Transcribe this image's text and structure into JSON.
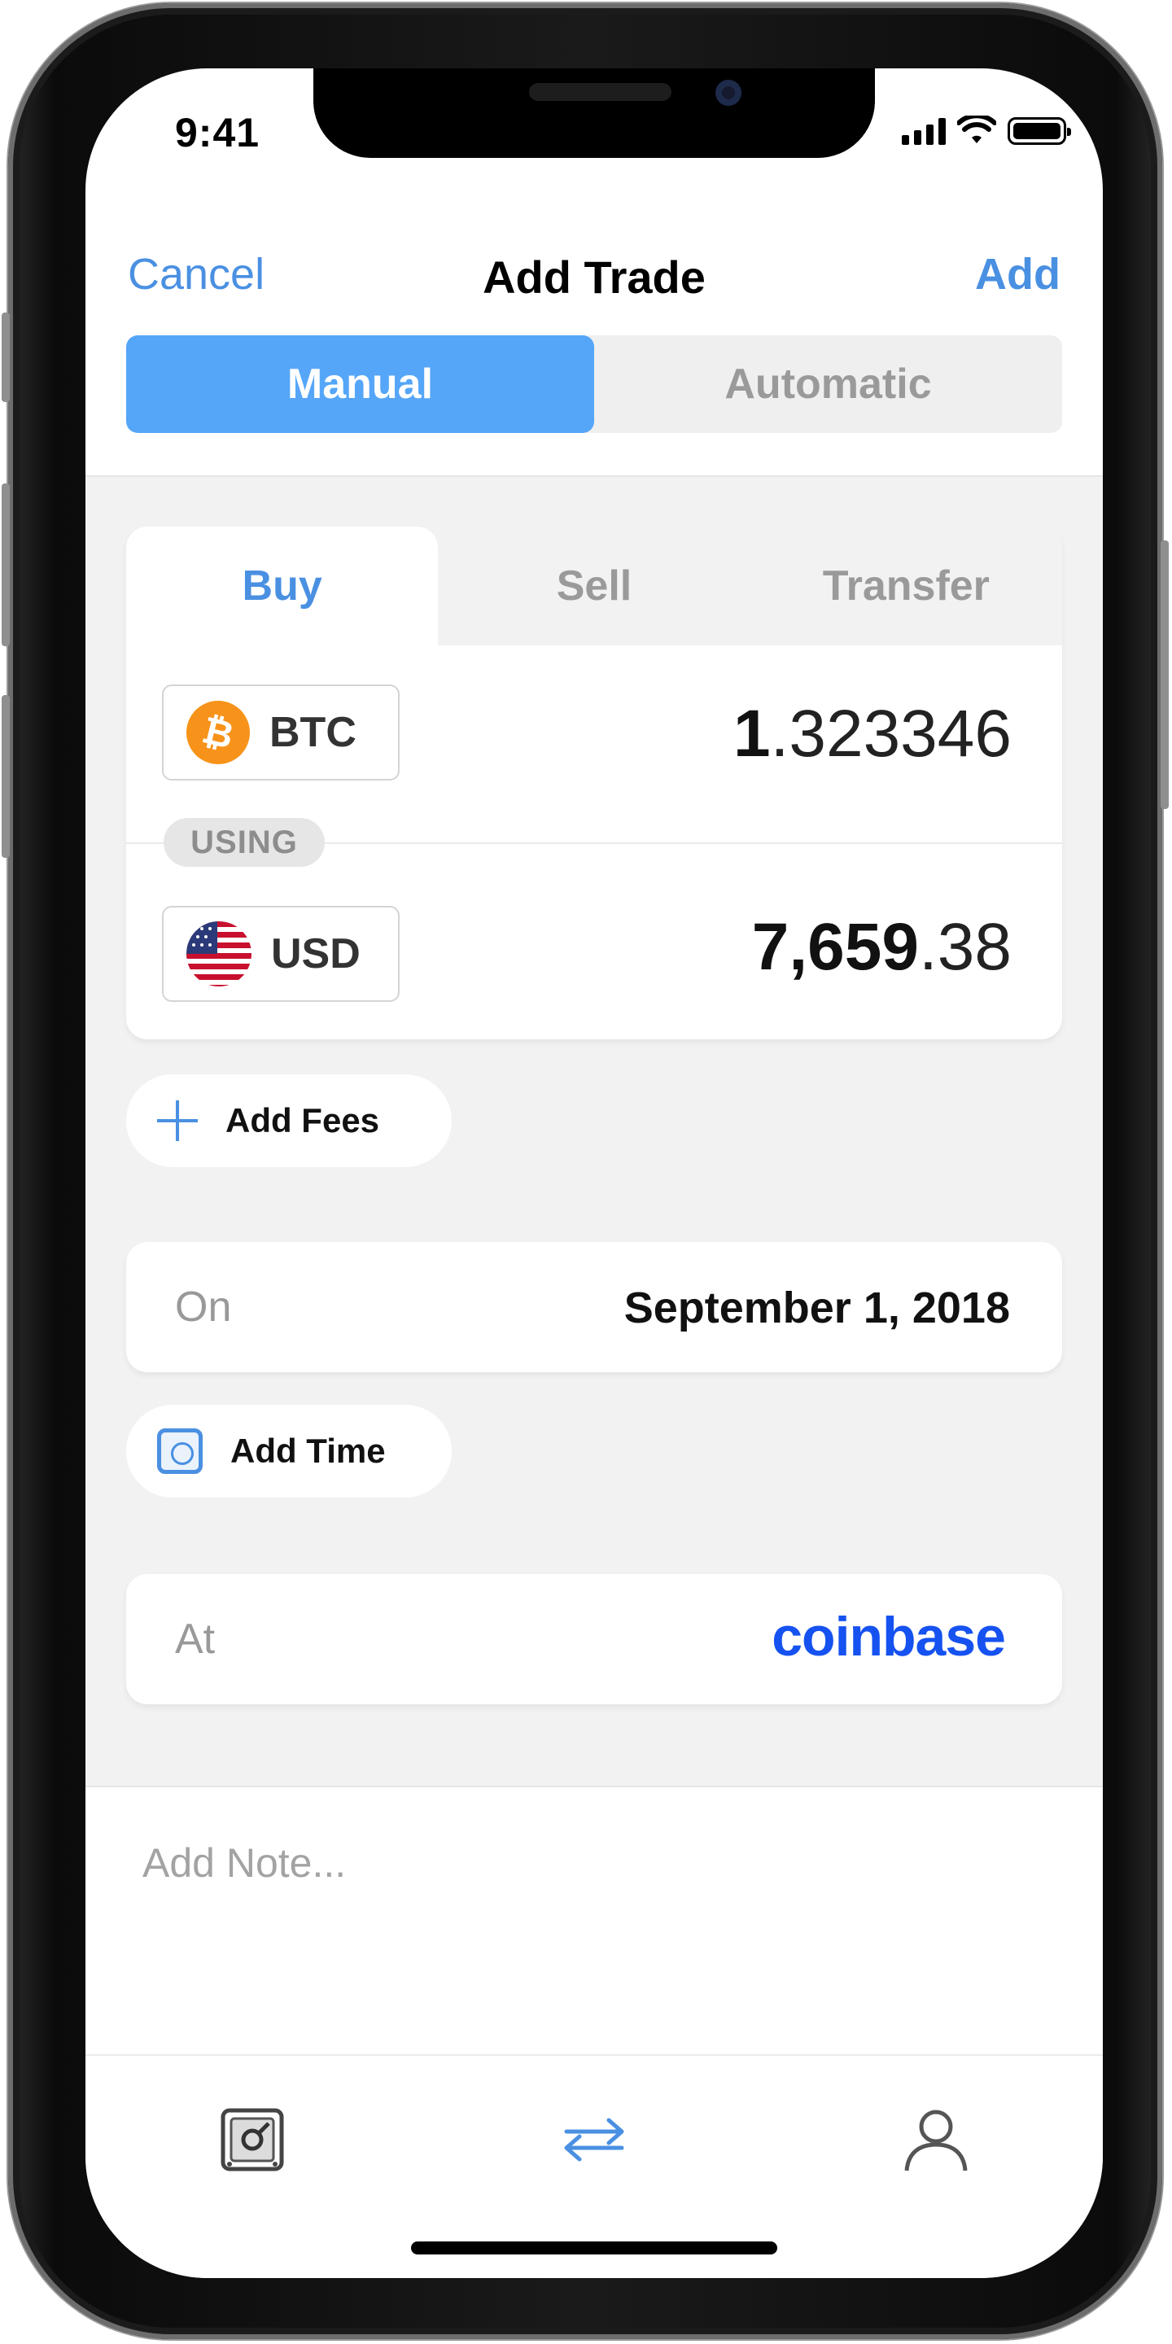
{
  "status_bar": {
    "time": "9:41"
  },
  "nav": {
    "cancel_label": "Cancel",
    "title": "Add Trade",
    "add_label": "Add"
  },
  "mode_segment": {
    "options": [
      "Manual",
      "Automatic"
    ],
    "selected": "Manual"
  },
  "trade_type_tabs": {
    "options": [
      "Buy",
      "Sell",
      "Transfer"
    ],
    "selected": "Buy"
  },
  "base_asset": {
    "symbol": "BTC",
    "icon": "bitcoin-icon",
    "amount_whole": "1",
    "amount_fraction": ".323346"
  },
  "using_label": "USING",
  "quote_asset": {
    "symbol": "USD",
    "icon": "us-flag-icon",
    "amount_whole": "7,659",
    "amount_fraction": ".38"
  },
  "add_fees": {
    "label": "Add Fees",
    "icon": "plus-icon"
  },
  "date_field": {
    "label": "On",
    "value": "September 1, 2018"
  },
  "add_time": {
    "label": "Add Time",
    "icon": "clock-icon"
  },
  "exchange_field": {
    "label": "At",
    "value": "coinbase"
  },
  "note": {
    "placeholder": "Add Note..."
  },
  "tab_bar": {
    "items": [
      "portfolio-icon",
      "transfer-arrows-icon",
      "profile-icon"
    ],
    "active": "transfer-arrows-icon"
  },
  "colors": {
    "accent": "#4a90e2",
    "segment_active": "#55a6f8",
    "bitcoin": "#f7931a",
    "coinbase": "#1652f0"
  }
}
